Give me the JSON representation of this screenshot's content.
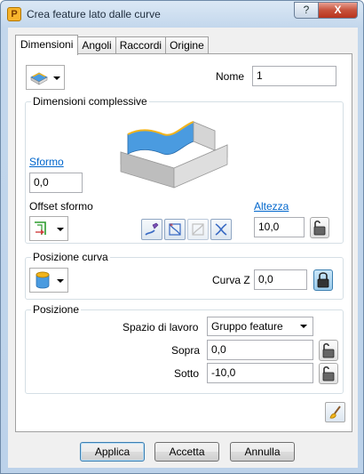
{
  "window": {
    "title": "Crea feature lato dalle curve",
    "help_label": "?",
    "close_label": "X"
  },
  "tabs": [
    {
      "label": "Dimensioni",
      "active": true
    },
    {
      "label": "Angoli"
    },
    {
      "label": "Raccordi"
    },
    {
      "label": "Origine"
    }
  ],
  "top": {
    "name_label": "Nome",
    "name_value": "1"
  },
  "dimensioni": {
    "title": "Dimensioni complessive",
    "sformo_label": "Sformo",
    "sformo_value": "0,0",
    "offset_label": "Offset sformo",
    "altezza_label": "Altezza",
    "altezza_value": "10,0"
  },
  "posizione_curva": {
    "title": "Posizione curva",
    "curva_z_label": "Curva Z",
    "curva_z_value": "0,0"
  },
  "posizione": {
    "title": "Posizione",
    "spazio_label": "Spazio di lavoro",
    "spazio_value": "Gruppo feature",
    "sopra_label": "Sopra",
    "sopra_value": "0,0",
    "sotto_label": "Sotto",
    "sotto_value": "-10,0"
  },
  "buttons": {
    "apply": "Applica",
    "accept": "Accetta",
    "cancel": "Annulla"
  },
  "colors": {
    "accent_blue": "#4a9be0",
    "accent_yellow": "#f2b41c",
    "body_grey": "#d8d8d8"
  }
}
